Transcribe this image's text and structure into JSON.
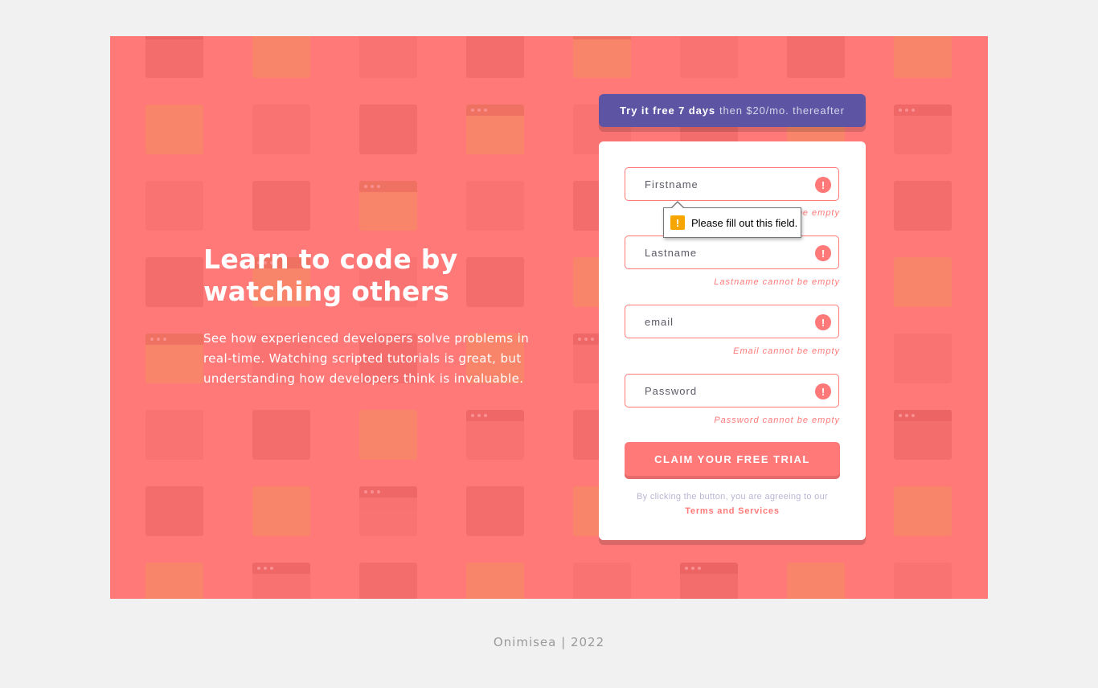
{
  "hero": {
    "title": "Learn to code by watching others",
    "description": "See how experienced developers solve problems in real-time. Watching scripted tutorials is great, but understanding how developers think is invaluable."
  },
  "promo": {
    "bold": "Try it free 7 days",
    "light": "then $20/mo. thereafter"
  },
  "form": {
    "fields": [
      {
        "placeholder": "Firstname",
        "error": "Firstname cannot be empty"
      },
      {
        "placeholder": "Lastname",
        "error": "Lastname cannot be empty"
      },
      {
        "placeholder": "email",
        "error": "Email cannot be empty"
      },
      {
        "placeholder": "Password",
        "error": "Password cannot be empty"
      }
    ],
    "error_icon": "!",
    "submit_label": "CLAIM YOUR FREE TRIAL",
    "terms_text": "By clicking the button, you are agreeing to our",
    "terms_link": "Terms and Services"
  },
  "tooltip": {
    "icon": "!",
    "text": "Please fill out this field."
  },
  "footer": {
    "text": "Onimisea | 2022"
  },
  "colors": {
    "background": "#f1f1f1",
    "hero": "#ff7979",
    "promo": "#5e54a4",
    "accent": "#ff7979",
    "warning": "#f7a600"
  }
}
